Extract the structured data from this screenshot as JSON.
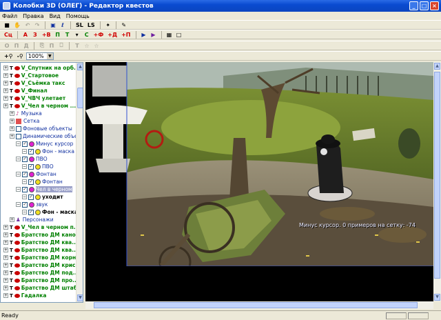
{
  "window": {
    "title": "Колобки 3D (ОЛЕГ) - Редактор квестов",
    "min": "_",
    "max": "□",
    "close": "×"
  },
  "menu": [
    "Файл",
    "Правка",
    "Вид",
    "Помощь"
  ],
  "toolbar1": {
    "sl": "SL",
    "ls": "LS"
  },
  "toolbar2": [
    "Сц",
    "А",
    "З",
    "+В",
    "П",
    "Т",
    "С",
    "+Ф",
    "+Д",
    "+П"
  ],
  "toolbar3": [
    "О",
    "П",
    "Д",
    "П",
    "Т"
  ],
  "zoom": {
    "value": "100%"
  },
  "tree": [
    {
      "indent": 0,
      "label": "V_Спутник на орб...",
      "style": "green",
      "icon": "eye"
    },
    {
      "indent": 0,
      "label": "V_Стартовое",
      "style": "green",
      "icon": "eye"
    },
    {
      "indent": 0,
      "label": "V_Съёмка такс",
      "style": "green",
      "icon": "eye"
    },
    {
      "indent": 0,
      "label": "V_Финал",
      "style": "green",
      "icon": "eye"
    },
    {
      "indent": 0,
      "label": "V_ЧВЧ улетает",
      "style": "green",
      "icon": "eye"
    },
    {
      "indent": 0,
      "label": "V_Чел в черном ...",
      "style": "green",
      "icon": "eye"
    },
    {
      "indent": 1,
      "label": "Музыка",
      "style": "blue",
      "icon": "note"
    },
    {
      "indent": 1,
      "label": "Сетка",
      "style": "blue",
      "icon": "grid"
    },
    {
      "indent": 1,
      "label": "Фоновые объекты",
      "style": "blue",
      "icon": "box"
    },
    {
      "indent": 1,
      "label": "Динамические объе...",
      "style": "blue",
      "icon": "box"
    },
    {
      "indent": 2,
      "label": "Минус курсор",
      "style": "blue",
      "icon": "magenta"
    },
    {
      "indent": 3,
      "label": "Фон - маска",
      "style": "blue",
      "icon": "yellow"
    },
    {
      "indent": 2,
      "label": "ПВО",
      "style": "blue",
      "icon": "magenta"
    },
    {
      "indent": 3,
      "label": "ПВО",
      "style": "blue",
      "icon": "yellow"
    },
    {
      "indent": 2,
      "label": "Фонтан",
      "style": "blue",
      "icon": "magenta"
    },
    {
      "indent": 3,
      "label": "Фонтан",
      "style": "blue",
      "icon": "yellow"
    },
    {
      "indent": 2,
      "label": "Чел в черном",
      "style": "sel",
      "icon": "magenta"
    },
    {
      "indent": 3,
      "label": "уходит",
      "style": "bold",
      "icon": "yellow"
    },
    {
      "indent": 2,
      "label": "звук",
      "style": "blue",
      "icon": "magenta"
    },
    {
      "indent": 3,
      "label": "Фон - маска",
      "style": "bold",
      "icon": "yellow"
    },
    {
      "indent": 1,
      "label": "Персонажи",
      "style": "blue",
      "icon": "person"
    },
    {
      "indent": 0,
      "label": "V_Чел в черном п...",
      "style": "green",
      "icon": "eye"
    },
    {
      "indent": 0,
      "label": "Братство ДМ кано...",
      "style": "green",
      "icon": "eye"
    },
    {
      "indent": 0,
      "label": "Братство ДМ ква...",
      "style": "green",
      "icon": "eye"
    },
    {
      "indent": 0,
      "label": "Братство ДМ ква...",
      "style": "green",
      "icon": "eye"
    },
    {
      "indent": 0,
      "label": "Братство ДМ корн...",
      "style": "green",
      "icon": "eye"
    },
    {
      "indent": 0,
      "label": "Братство ДМ крис...",
      "style": "green",
      "icon": "eye"
    },
    {
      "indent": 0,
      "label": "Братство ДМ под...",
      "style": "green",
      "icon": "eye"
    },
    {
      "indent": 0,
      "label": "Братство ДМ про...",
      "style": "green",
      "icon": "eye"
    },
    {
      "indent": 0,
      "label": "Братство ДМ штаб",
      "style": "green",
      "icon": "eye"
    },
    {
      "indent": 0,
      "label": "Гадалка",
      "style": "green",
      "icon": "eye"
    }
  ],
  "scene": {
    "overlay": "Минус курсор. 0 примеров на сетку: -74"
  },
  "status": {
    "text": "Ready"
  }
}
